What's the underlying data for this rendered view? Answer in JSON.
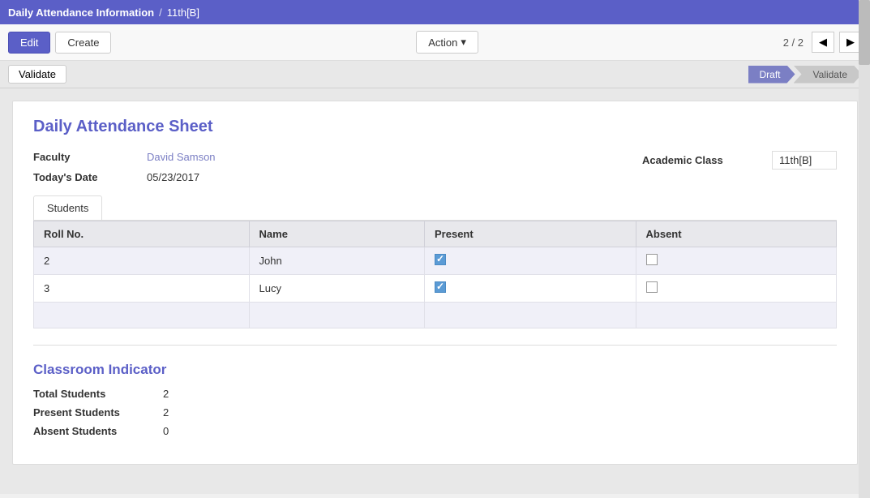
{
  "topbar": {
    "breadcrumb_main": "Daily Attendance Information",
    "separator": "/",
    "breadcrumb_sub": "11th[B]"
  },
  "toolbar": {
    "edit_label": "Edit",
    "create_label": "Create",
    "action_label": "Action",
    "pagination": "2 / 2",
    "prev_icon": "◀",
    "next_icon": "▶"
  },
  "statusbar": {
    "validate_btn": "Validate",
    "steps": [
      {
        "label": "Draft",
        "active": true
      },
      {
        "label": "Validate",
        "active": false
      }
    ]
  },
  "card": {
    "title": "Daily Attendance Sheet",
    "faculty_label": "Faculty",
    "faculty_value": "David Samson",
    "date_label": "Today's Date",
    "date_value": "05/23/2017",
    "academic_class_label": "Academic Class",
    "academic_class_value": "11th[B]"
  },
  "tabs": [
    {
      "label": "Students"
    }
  ],
  "table": {
    "headers": [
      "Roll No.",
      "Name",
      "Present",
      "Absent"
    ],
    "rows": [
      {
        "roll": "2",
        "name": "John",
        "present": true,
        "absent": false
      },
      {
        "roll": "3",
        "name": "Lucy",
        "present": true,
        "absent": false
      }
    ]
  },
  "classroom_indicator": {
    "title": "Classroom Indicator",
    "total_label": "Total Students",
    "total_value": "2",
    "present_label": "Present Students",
    "present_value": "2",
    "absent_label": "Absent Students",
    "absent_value": "0"
  }
}
